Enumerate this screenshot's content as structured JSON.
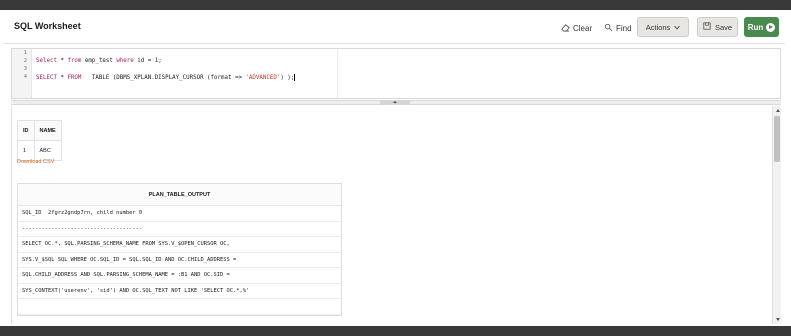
{
  "header": {
    "title": "SQL Worksheet",
    "clear_label": "Clear",
    "find_label": "Find",
    "actions_label": "Actions",
    "save_label": "Save",
    "run_label": "Run"
  },
  "editor": {
    "line_numbers": [
      "1",
      "2",
      "3",
      "4"
    ],
    "line2": {
      "a": "Select",
      "b": " * ",
      "c": "from",
      "d": " emp_test ",
      "e": "where",
      "f": " id = 1;"
    },
    "line4": {
      "a": "SELECT",
      "b": " * ",
      "c": "FROM",
      "d": "   TABLE (DBMS_XPLAN.DISPLAY_CURSOR (format => ",
      "e": "'ADVANCED'",
      "f": ") );"
    }
  },
  "results": {
    "columns": [
      "ID",
      "NAME"
    ],
    "row": [
      "1",
      "ABC"
    ],
    "download_label": "Download CSV",
    "plan_header": "PLAN_TABLE_OUTPUT",
    "plan_rows": [
      "SQL_ID  2fgrz2gndp7rn, child number 0",
      "-------------------------------------",
      "SELECT OC.*, SQL.PARSING_SCHEMA_NAME FROM SYS.V_$OPEN_CURSOR OC,",
      "SYS.V_$SQL SQL WHERE OC.SQL_ID = SQL.SQL_ID AND OC.CHILD_ADDRESS =",
      "SQL.CHILD_ADDRESS AND SQL.PARSING_SCHEMA_NAME = :B1 AND OC.SID =",
      "SYS_CONTEXT('userenv', 'sid') AND OC.SQL_TEXT NOT LIKE 'SELECT OC.*,%'",
      ""
    ]
  },
  "colors": {
    "run_green": "#4a8a4f",
    "download_link": "#c4651a",
    "frame": "#3b3937"
  },
  "icons": {
    "clear": "eraser-icon",
    "find": "find-icon",
    "actions": "chevron-down-icon",
    "save": "save-icon",
    "run": "play-icon"
  }
}
